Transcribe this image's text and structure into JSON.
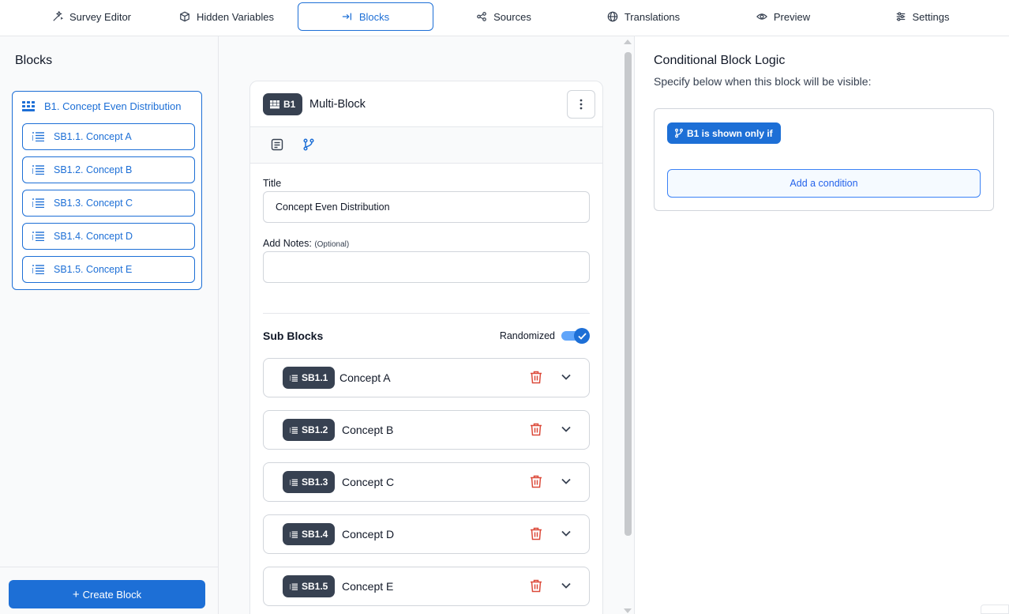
{
  "nav": {
    "tabs": [
      {
        "label": "Survey Editor",
        "icon": "magic-wand-icon"
      },
      {
        "label": "Hidden Variables",
        "icon": "cube-icon"
      },
      {
        "label": "Blocks",
        "icon": "arrow-to-line-icon",
        "active": true
      },
      {
        "label": "Sources",
        "icon": "share-nodes-icon"
      },
      {
        "label": "Translations",
        "icon": "globe-icon"
      },
      {
        "label": "Preview",
        "icon": "eye-icon"
      },
      {
        "label": "Settings",
        "icon": "sliders-icon"
      }
    ]
  },
  "sidebar": {
    "title": "Blocks",
    "block": {
      "label": "B1. Concept Even Distribution"
    },
    "items": [
      {
        "label": "SB1.1. Concept A"
      },
      {
        "label": "SB1.2. Concept B"
      },
      {
        "label": "SB1.3. Concept C"
      },
      {
        "label": "SB1.4. Concept D"
      },
      {
        "label": "SB1.5. Concept E"
      }
    ],
    "create_label": "Create Block"
  },
  "editor": {
    "badge": "B1",
    "title": "Multi-Block",
    "title_field": {
      "label": "Title",
      "value": "Concept Even Distribution"
    },
    "notes_field": {
      "label": "Add Notes:",
      "optional": "(Optional)",
      "value": ""
    },
    "sub_blocks_title": "Sub Blocks",
    "randomized_label": "Randomized",
    "randomized": true,
    "sub_blocks": [
      {
        "badge": "SB1.1",
        "name": "Concept A"
      },
      {
        "badge": "SB1.2",
        "name": "Concept B"
      },
      {
        "badge": "SB1.3",
        "name": "Concept C"
      },
      {
        "badge": "SB1.4",
        "name": "Concept D"
      },
      {
        "badge": "SB1.5",
        "name": "Concept E"
      }
    ]
  },
  "logic": {
    "title": "Conditional Block Logic",
    "subtitle": "Specify below when this block will be visible:",
    "pill": "B1 is shown only if",
    "add_condition": "Add a condition"
  },
  "colors": {
    "accent": "#1d6fd6",
    "badge": "#374151",
    "danger": "#dc4a3a"
  }
}
